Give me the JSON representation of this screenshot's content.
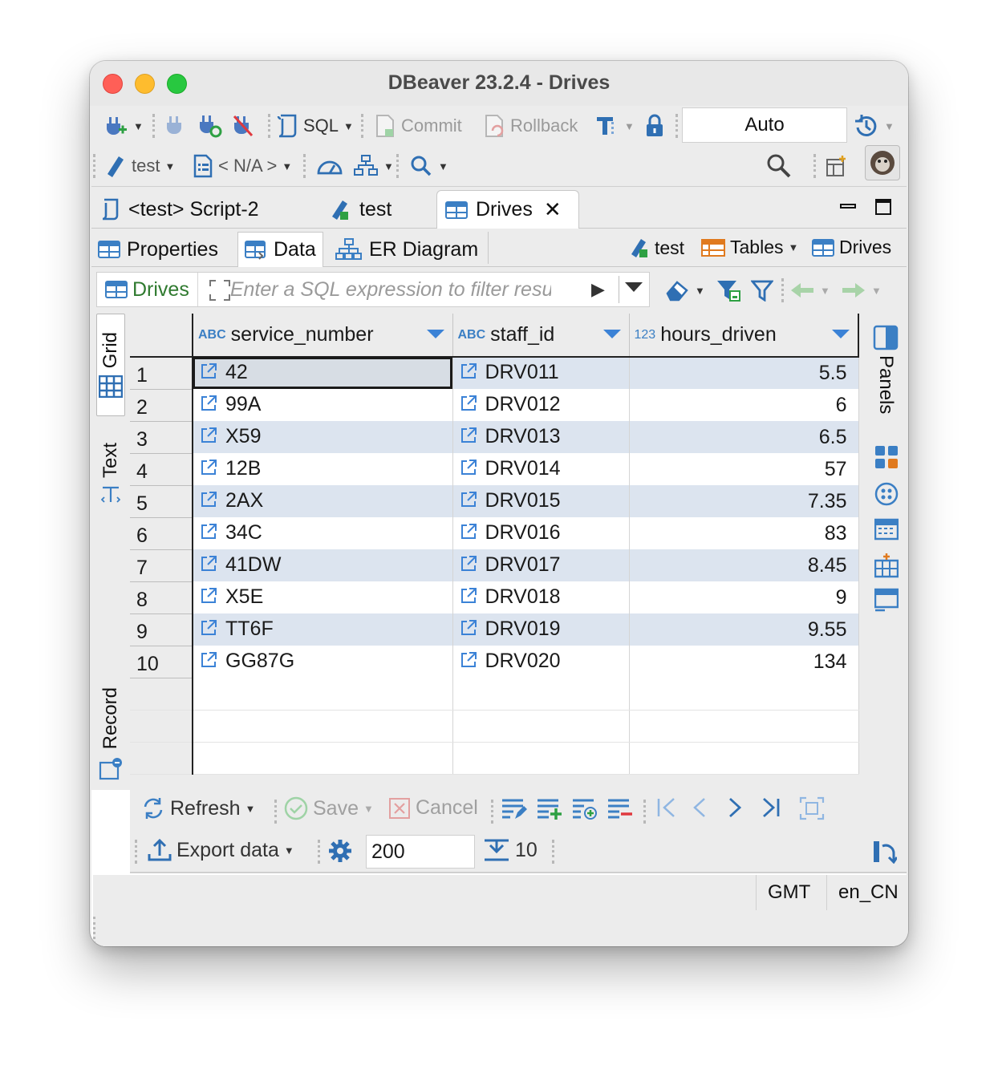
{
  "window": {
    "title": "DBeaver 23.2.4 - Drives"
  },
  "toolbar": {
    "sql_label": "SQL",
    "commit_label": "Commit",
    "rollback_label": "Rollback",
    "transaction_mode": "Auto",
    "connection_label": "test",
    "schema_label": "< N/A >"
  },
  "editor_tabs": [
    {
      "label": "<test> Script-2",
      "icon": "sql-script-icon"
    },
    {
      "label": "test",
      "icon": "connection-icon"
    },
    {
      "label": "Drives",
      "icon": "table-icon",
      "active": true
    }
  ],
  "sub_tabs": [
    {
      "label": "Properties",
      "icon": "table-icon"
    },
    {
      "label": "Data",
      "icon": "data-grid-icon",
      "active": true
    },
    {
      "label": "ER Diagram",
      "icon": "er-diagram-icon"
    }
  ],
  "context": {
    "connection": "test",
    "folder": "Tables",
    "table": "Drives"
  },
  "filter": {
    "entity": "Drives",
    "placeholder": "Enter a SQL expression to filter results (use Ctrl+Space)"
  },
  "left_tabs": {
    "grid": "Grid",
    "text": "Text",
    "record": "Record"
  },
  "right_tabs": {
    "panels": "Panels"
  },
  "grid": {
    "columns": [
      {
        "name": "service_number",
        "type": "ABC"
      },
      {
        "name": "staff_id",
        "type": "ABC"
      },
      {
        "name": "hours_driven",
        "type": "123"
      }
    ],
    "rows": [
      [
        "1",
        "42",
        "DRV011",
        "5.5"
      ],
      [
        "2",
        "99A",
        "DRV012",
        "6"
      ],
      [
        "3",
        "X59",
        "DRV013",
        "6.5"
      ],
      [
        "4",
        "12B",
        "DRV014",
        "57"
      ],
      [
        "5",
        "2AX",
        "DRV015",
        "7.35"
      ],
      [
        "6",
        "34C",
        "DRV016",
        "83"
      ],
      [
        "7",
        "41DW",
        "DRV017",
        "8.45"
      ],
      [
        "8",
        "X5E",
        "DRV018",
        "9"
      ],
      [
        "9",
        "TT6F",
        "DRV019",
        "9.55"
      ],
      [
        "10",
        "GG87G",
        "DRV020",
        "134"
      ]
    ]
  },
  "bottom": {
    "refresh": "Refresh",
    "save": "Save",
    "cancel": "Cancel",
    "export": "Export data",
    "fetch_size": "200",
    "row_count": "10"
  },
  "status": {
    "timezone": "GMT",
    "locale": "en_CN"
  },
  "colors": {
    "accent": "#3b82d6",
    "alt_row": "#dce4ef",
    "entity_green": "#2f7a2f"
  }
}
